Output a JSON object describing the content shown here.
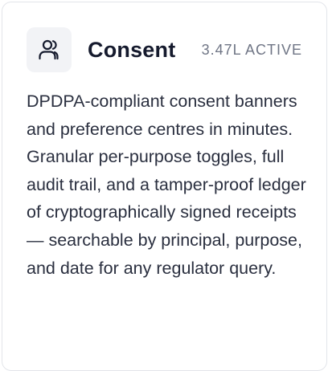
{
  "card": {
    "icon": "user-icon",
    "title": "Consent",
    "badge": "3.47L ACTIVE",
    "description": "DPDPA-compliant consent banners and preference centres in minutes. Granular per-purpose toggles, full audit trail, and a tamper-proof ledger of cryptographically signed receipts — searchable by principal, purpose, and date for any regulator query."
  },
  "colors": {
    "title": "#151a2d",
    "badge": "#6f7585",
    "icon_background": "#f2f3f6",
    "border": "#e3e5ea"
  }
}
